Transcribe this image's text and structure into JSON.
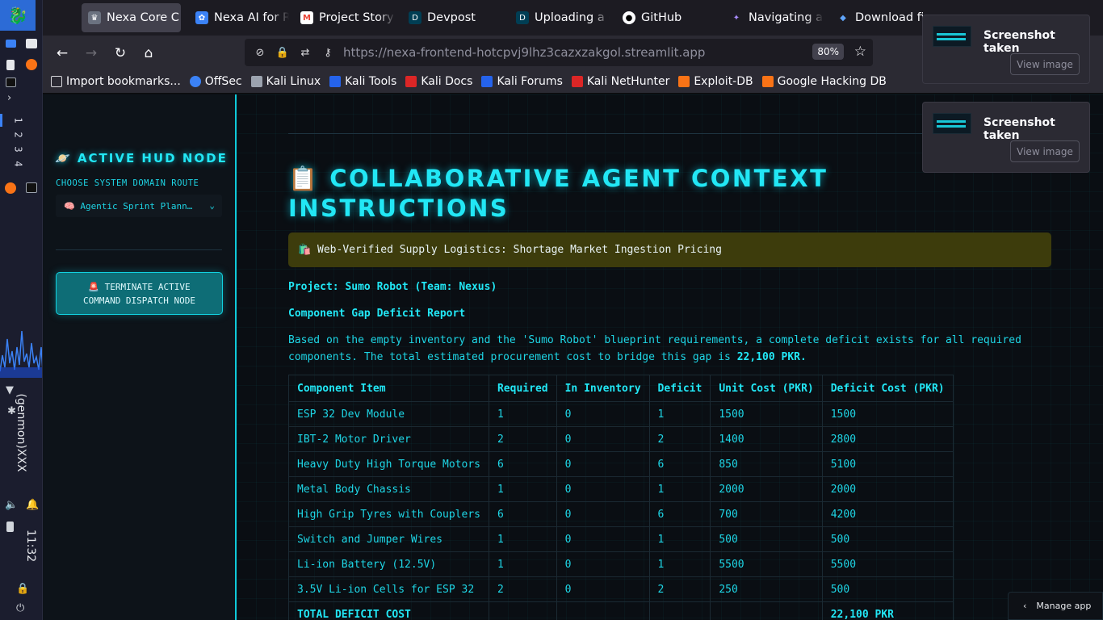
{
  "taskbar": {
    "workspaces": [
      "1",
      "2",
      "3",
      "4"
    ],
    "user": "(genmon)XXX",
    "time": "11:32"
  },
  "browser": {
    "tabs": [
      {
        "label": "Nexa Core C",
        "icon": "crown-icon",
        "active": true
      },
      {
        "label": "Nexa AI for Re",
        "icon": "gear-icon",
        "active": false
      },
      {
        "label": "Project Story",
        "icon": "gmail-icon",
        "active": false
      },
      {
        "label": "Devpost",
        "icon": "devpost-icon",
        "active": false
      },
      {
        "label": "Uploading a d",
        "icon": "devpost-icon",
        "active": false
      },
      {
        "label": "GitHub",
        "icon": "github-icon",
        "active": false
      },
      {
        "label": "Navigating a S",
        "icon": "sparkle-icon",
        "active": false
      },
      {
        "label": "Download fil",
        "icon": "heart-icon",
        "active": false
      }
    ],
    "url": "https://nexa-frontend-hotcpvj9lhz3cazxzakgol.streamlit.app",
    "zoom": "80%",
    "bookmarks": [
      {
        "label": "Import bookmarks...",
        "color": "#d7d7db"
      },
      {
        "label": "OffSec",
        "color": "#3b82f6"
      },
      {
        "label": "Kali Linux",
        "color": "#9ca3af"
      },
      {
        "label": "Kali Tools",
        "color": "#2563eb"
      },
      {
        "label": "Kali Docs",
        "color": "#dc2626"
      },
      {
        "label": "Kali Forums",
        "color": "#2563eb"
      },
      {
        "label": "Kali NetHunter",
        "color": "#dc2626"
      },
      {
        "label": "Exploit-DB",
        "color": "#f97316"
      },
      {
        "label": "Google Hacking DB",
        "color": "#f97316"
      }
    ]
  },
  "sidebar": {
    "title": "🪐 ACTIVE HUD NODE",
    "route_label": "CHOOSE SYSTEM DOMAIN ROUTE",
    "route_value": "🧠 Agentic Sprint Plann…",
    "terminate_line1": "🚨 TERMINATE ACTIVE",
    "terminate_line2": "COMMAND DISPATCH NODE"
  },
  "main": {
    "title": "📋 COLLABORATIVE AGENT CONTEXT INSTRUCTIONS",
    "alert": "🛍️ Web-Verified Supply Logistics: Shortage Market Ingestion Pricing",
    "project": "Project: Sumo Robot (Team: Nexus)",
    "report_title": "Component Gap Deficit Report",
    "paragraph_text": "Based on the empty inventory and the 'Sumo Robot' blueprint requirements, a complete deficit exists for all required components. The total estimated procurement cost to bridge this gap is ",
    "paragraph_total": "22,100 PKR.",
    "table": {
      "headers": [
        "Component Item",
        "Required",
        "In Inventory",
        "Deficit",
        "Unit Cost (PKR)",
        "Deficit Cost (PKR)"
      ],
      "rows": [
        [
          "ESP 32 Dev Module",
          "1",
          "0",
          "1",
          "1500",
          "1500"
        ],
        [
          "IBT-2 Motor Driver",
          "2",
          "0",
          "2",
          "1400",
          "2800"
        ],
        [
          "Heavy Duty High Torque Motors",
          "6",
          "0",
          "6",
          "850",
          "5100"
        ],
        [
          "Metal Body Chassis",
          "1",
          "0",
          "1",
          "2000",
          "2000"
        ],
        [
          "High Grip Tyres with Couplers",
          "6",
          "0",
          "6",
          "700",
          "4200"
        ],
        [
          "Switch and Jumper Wires",
          "1",
          "0",
          "1",
          "500",
          "500"
        ],
        [
          "Li-ion Battery (12.5V)",
          "1",
          "0",
          "1",
          "5500",
          "5500"
        ],
        [
          "3.5V Li-ion Cells for ESP 32",
          "2",
          "0",
          "2",
          "250",
          "500"
        ]
      ],
      "total_label": "TOTAL DEFICIT COST",
      "total_value": "22,100 PKR"
    }
  },
  "overlays": {
    "toasts": [
      {
        "title": "Screenshot taken",
        "button": "View image"
      },
      {
        "title": "Screenshot taken",
        "button": "View image"
      }
    ],
    "manage_app": "Manage app"
  },
  "colors": {
    "accent": "#22e7f5",
    "alert_bg": "#3d3c0c",
    "button_bg": "#0e6d76"
  }
}
